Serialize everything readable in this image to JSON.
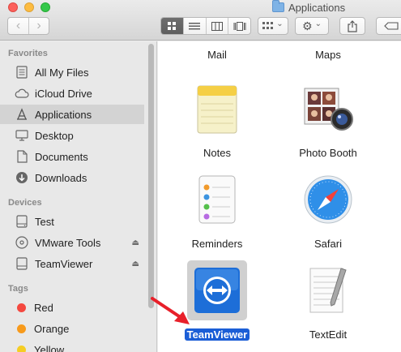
{
  "window": {
    "title": "Applications"
  },
  "toolbar": {
    "back_glyph": "‹",
    "forward_glyph": "›",
    "view_icons": [
      "icon-view",
      "list-view",
      "column-view",
      "coverflow-view"
    ],
    "arrange_chevron": "⌄",
    "action_glyph": "⚙",
    "action_chevron": "⌄"
  },
  "sidebar": {
    "sections": {
      "favorites": "Favorites",
      "devices": "Devices",
      "tags": "Tags"
    },
    "favorites": [
      {
        "label": "All My Files",
        "icon": "all-files-icon"
      },
      {
        "label": "iCloud Drive",
        "icon": "cloud-icon"
      },
      {
        "label": "Applications",
        "icon": "applications-icon",
        "selected": true
      },
      {
        "label": "Desktop",
        "icon": "desktop-icon"
      },
      {
        "label": "Documents",
        "icon": "document-icon"
      },
      {
        "label": "Downloads",
        "icon": "download-icon"
      }
    ],
    "devices": [
      {
        "label": "Test",
        "icon": "hard-drive-icon"
      },
      {
        "label": "VMware Tools",
        "icon": "disc-icon",
        "eject": true
      },
      {
        "label": "TeamViewer",
        "icon": "drive-icon",
        "eject": true
      }
    ],
    "tags": [
      {
        "label": "Red",
        "color": "#f4483f"
      },
      {
        "label": "Orange",
        "color": "#f79a1b"
      },
      {
        "label": "Yellow",
        "color": "#f5cd24"
      }
    ]
  },
  "content": {
    "items": [
      {
        "label": "Mail"
      },
      {
        "label": "Maps"
      },
      {
        "label": "Notes",
        "icon": "notes-icon"
      },
      {
        "label": "Photo Booth",
        "icon": "photo-booth-icon"
      },
      {
        "label": "Reminders",
        "icon": "reminders-icon"
      },
      {
        "label": "Safari",
        "icon": "safari-icon"
      },
      {
        "label": "TeamViewer",
        "icon": "teamviewer-icon",
        "selected": true
      },
      {
        "label": "TextEdit",
        "icon": "textedit-icon"
      }
    ]
  },
  "colors": {
    "selection": "#1b5ed6",
    "arrow": "#e8202a"
  }
}
